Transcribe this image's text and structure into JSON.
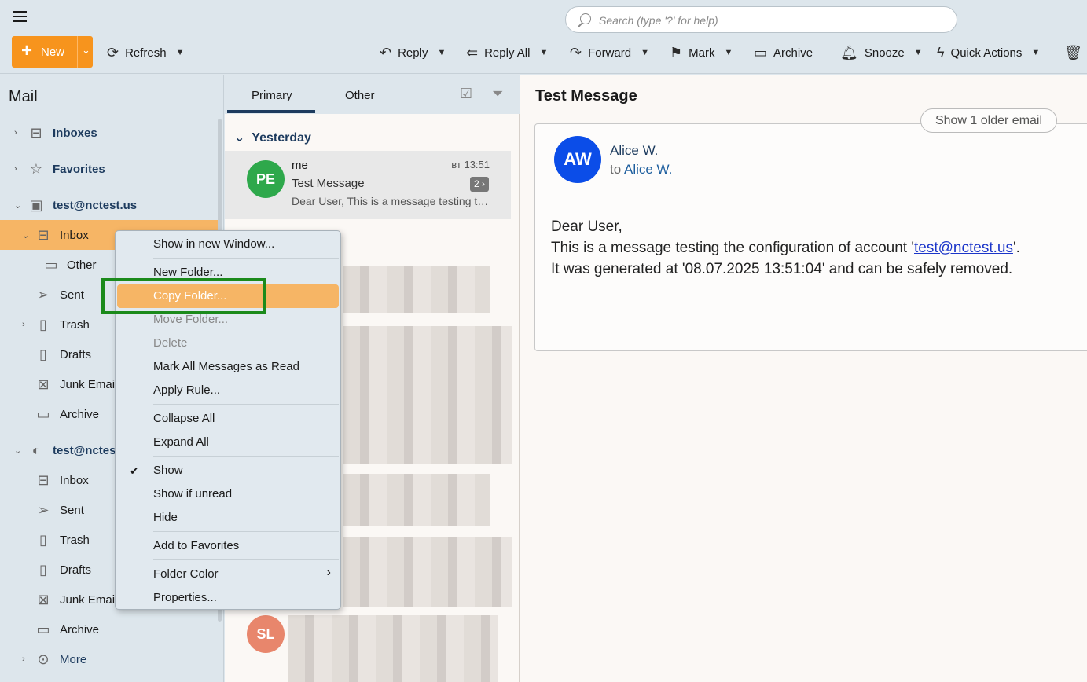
{
  "search": {
    "placeholder": "Search (type '?' for help)"
  },
  "toolbar": {
    "new_label": "New",
    "refresh_label": "Refresh",
    "reply_label": "Reply",
    "reply_all_label": "Reply All",
    "forward_label": "Forward",
    "mark_label": "Mark",
    "archive_label": "Archive",
    "snooze_label": "Snooze",
    "quick_actions_label": "Quick Actions"
  },
  "sidebar": {
    "title": "Mail",
    "items": [
      {
        "label": "Inboxes",
        "icon": "inbox-icon"
      },
      {
        "label": "Favorites",
        "icon": "star-icon"
      },
      {
        "label": "test@nctest.us",
        "icon": "account-icon"
      },
      {
        "label": "Inbox",
        "icon": "inbox-icon"
      },
      {
        "label": "Other",
        "icon": "folder-icon"
      },
      {
        "label": "Sent",
        "icon": "sent-icon"
      },
      {
        "label": "Trash",
        "icon": "trash-icon"
      },
      {
        "label": "Drafts",
        "icon": "drafts-icon"
      },
      {
        "label": "Junk Email",
        "icon": "junk-icon"
      },
      {
        "label": "Archive",
        "icon": "archive-icon"
      },
      {
        "label": "test@nctest",
        "icon": "account-icon"
      },
      {
        "label": "Inbox",
        "icon": "inbox-icon"
      },
      {
        "label": "Sent",
        "icon": "sent-icon"
      },
      {
        "label": "Trash",
        "icon": "trash-icon"
      },
      {
        "label": "Drafts",
        "icon": "drafts-icon"
      },
      {
        "label": "Junk Email",
        "icon": "junk-icon"
      },
      {
        "label": "Archive",
        "icon": "archive-icon"
      },
      {
        "label": "More",
        "icon": "more-icon"
      }
    ]
  },
  "msglist": {
    "tabs": [
      "Primary",
      "Other"
    ],
    "group": "Yesterday",
    "message": {
      "avatar": "PE",
      "from": "me",
      "time": "вт 13:51",
      "subject": "Test Message",
      "preview": "Dear User, This is a message testing the configuration",
      "count": "2 ›"
    },
    "second_avatar": "SL"
  },
  "reading": {
    "title": "Test Message",
    "older_button": "Show 1 older email",
    "avatar": "AW",
    "sender": "Alice W.",
    "to_prefix": "to",
    "to_name": "Alice W.",
    "line1": "Dear User,",
    "line2_pre": "This is a message testing the configuration of account '",
    "line2_link": "test@nctest.us",
    "line2_post": "'.",
    "line3": "It was generated at '08.07.2025 13:51:04' and can be safely removed."
  },
  "context_menu": {
    "items": [
      "Show in new Window...",
      "New Folder...",
      "Copy Folder...",
      "Move Folder...",
      "Delete",
      "Mark All Messages as Read",
      "Apply Rule...",
      "Collapse All",
      "Expand All",
      "Show",
      "Show if unread",
      "Hide",
      "Add to Favorites",
      "Folder Color",
      "Properties..."
    ]
  },
  "colors": {
    "accent": "#f7941d",
    "selected": "#f6b565",
    "highlight_box": "#1b8a1b",
    "avatar_blue": "#0b4de8"
  }
}
